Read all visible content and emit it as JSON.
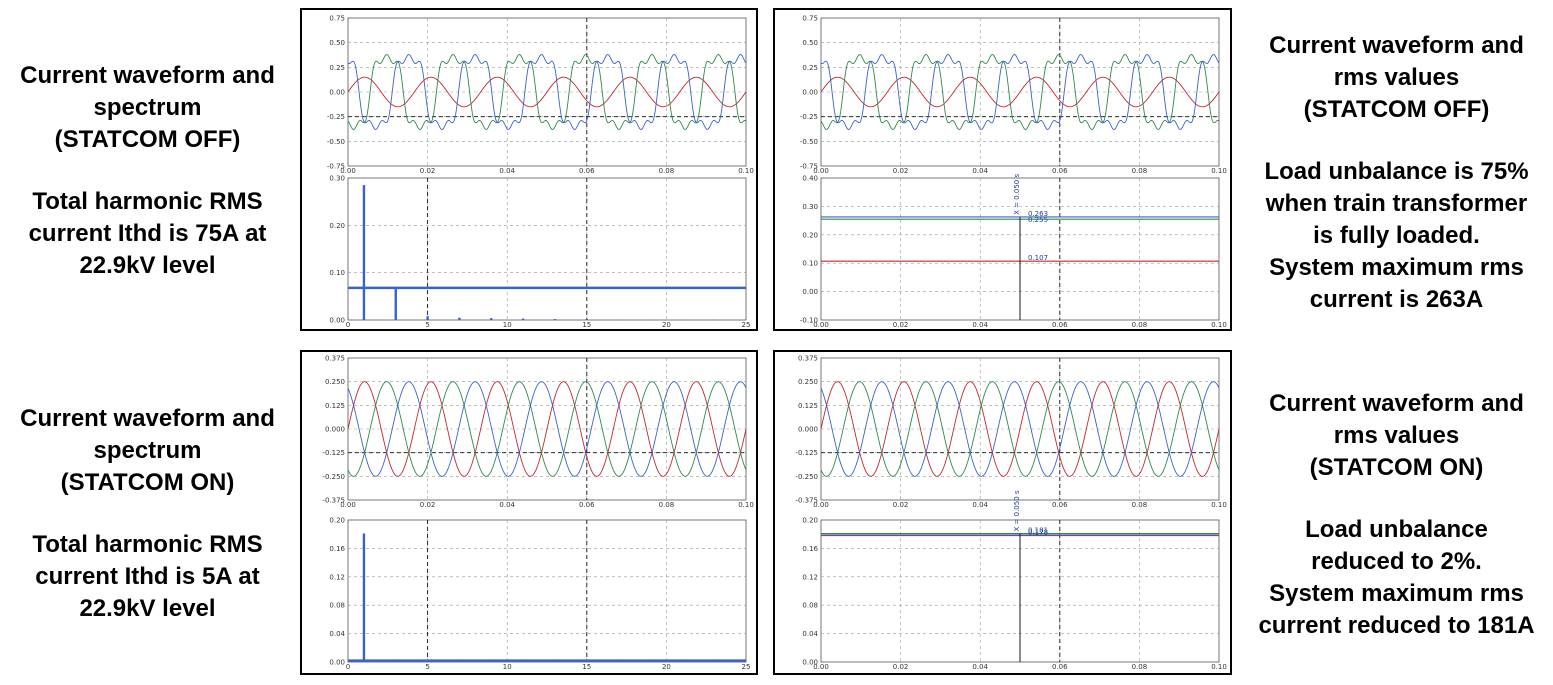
{
  "captions": {
    "top_left": {
      "title": [
        "Current waveform and",
        "spectrum",
        "(STATCOM OFF)"
      ],
      "body": [
        "Total harmonic RMS",
        "current Ithd is 75A at",
        "22.9kV level"
      ]
    },
    "top_right": {
      "title": [
        "Current waveform and",
        "rms values",
        "(STATCOM OFF)"
      ],
      "body": [
        "Load unbalance is 75%",
        "when train transformer",
        "is fully loaded.",
        "System maximum rms",
        "current is 263A"
      ]
    },
    "bottom_left": {
      "title": [
        "Current waveform and",
        "spectrum",
        "(STATCOM ON)"
      ],
      "body": [
        "Total harmonic RMS",
        "current Ithd is 5A at",
        "22.9kV level"
      ]
    },
    "bottom_right": {
      "title": [
        "Current waveform and",
        "rms values",
        "(STATCOM ON)"
      ],
      "body": [
        "Load unbalance",
        "reduced to 2%.",
        "System maximum rms",
        "current reduced to 181A"
      ]
    }
  },
  "colors": {
    "phase_a": "#c0282f",
    "phase_b": "#2d8a4e",
    "phase_c": "#3a63c8",
    "bar": "#3a63c8",
    "marker": "#1a1a1a",
    "grid": "#9a9a9a"
  },
  "chart_data": [
    {
      "id": "off-waveform",
      "type": "line",
      "xlim": [
        0,
        0.1
      ],
      "ylim": [
        -0.75,
        0.75
      ],
      "yticks": [
        "0.75",
        "0.50",
        "0.25",
        "0.00",
        "-0.25",
        "-0.50",
        "-0.75"
      ],
      "xticks": [
        "0.00",
        "0.02",
        "0.04",
        "0.06",
        "0.08",
        "0.10"
      ],
      "series": [
        {
          "amplitude": 0.15,
          "phase_deg": 0,
          "h3": 0.0,
          "h5": 0.0
        },
        {
          "amplitude": 0.4,
          "phase_deg": -120,
          "h3": 0.08,
          "h5": 0.06
        },
        {
          "amplitude": 0.4,
          "phase_deg": 120,
          "h3": 0.08,
          "h5": 0.06
        }
      ]
    },
    {
      "id": "off-spectrum",
      "type": "bar",
      "xlim": [
        0,
        25
      ],
      "ylim": [
        0,
        0.3
      ],
      "yticks": [
        "0.30",
        "0.20",
        "0.10",
        "0.00"
      ],
      "xticks": [
        "0",
        "5",
        "10",
        "15",
        "20",
        "25"
      ],
      "harmonics": [
        1,
        3,
        5,
        7,
        9,
        11,
        13,
        15,
        17,
        19,
        21,
        23
      ],
      "values": [
        0.285,
        0.068,
        0.008,
        0.005,
        0.004,
        0.003,
        0.002,
        0.002,
        0.001,
        0.001,
        0.001,
        0.001
      ],
      "ithd_level": 0.068
    },
    {
      "id": "off-rms-waveform",
      "type": "line",
      "xlim": [
        0,
        0.1
      ],
      "ylim": [
        -0.75,
        0.75
      ],
      "yticks": [
        "0.75",
        "0.50",
        "0.25",
        "0.00",
        "-0.25",
        "-0.50",
        "-0.75"
      ],
      "xticks": [
        "0.00",
        "0.02",
        "0.04",
        "0.06",
        "0.08",
        "0.10"
      ]
    },
    {
      "id": "off-rms",
      "type": "line",
      "xlim": [
        0,
        0.1
      ],
      "ylim": [
        -0.1,
        0.4
      ],
      "yticks": [
        "0.40",
        "0.30",
        "0.20",
        "0.10",
        "0.00",
        "-0.10"
      ],
      "xticks": [
        "0.00",
        "0.02",
        "0.04",
        "0.06",
        "0.08",
        "0.10"
      ],
      "rms": [
        0.107,
        0.255,
        0.263
      ],
      "cursor_x": 0.05,
      "cursor_label": "X = 0.050 s",
      "value_labels": [
        "0.263",
        "0.255",
        "0.107"
      ]
    },
    {
      "id": "on-waveform",
      "type": "line",
      "xlim": [
        0,
        0.1
      ],
      "ylim": [
        -0.375,
        0.375
      ],
      "yticks": [
        "0.375",
        "0.250",
        "0.125",
        "0.000",
        "-0.125",
        "-0.250",
        "-0.375"
      ],
      "xticks": [
        "0.00",
        "0.02",
        "0.04",
        "0.06",
        "0.08",
        "0.10"
      ],
      "series": [
        {
          "amplitude": 0.25,
          "phase_deg": 0,
          "h3": 0,
          "h5": 0
        },
        {
          "amplitude": 0.25,
          "phase_deg": -120,
          "h3": 0,
          "h5": 0
        },
        {
          "amplitude": 0.25,
          "phase_deg": 120,
          "h3": 0,
          "h5": 0
        }
      ]
    },
    {
      "id": "on-spectrum",
      "type": "bar",
      "xlim": [
        0,
        25
      ],
      "ylim": [
        0,
        0.2
      ],
      "yticks": [
        "0.20",
        "0.16",
        "0.12",
        "0.08",
        "0.04",
        "0.00"
      ],
      "xticks": [
        "0",
        "5",
        "10",
        "15",
        "20",
        "25"
      ],
      "harmonics": [
        1,
        3,
        5,
        7,
        9,
        11,
        13,
        15,
        17,
        19,
        21,
        23
      ],
      "values": [
        0.181,
        0.002,
        0.002,
        0.001,
        0.001,
        0.001,
        0.001,
        0.001,
        0.001,
        0.001,
        0.001,
        0.001
      ],
      "ithd_level": 0.002
    },
    {
      "id": "on-rms-waveform",
      "type": "line",
      "xlim": [
        0,
        0.1
      ],
      "ylim": [
        -0.375,
        0.375
      ],
      "yticks": [
        "0.375",
        "0.250",
        "0.125",
        "0.000",
        "-0.125",
        "-0.250",
        "-0.375"
      ],
      "xticks": [
        "0.00",
        "0.02",
        "0.04",
        "0.06",
        "0.08",
        "0.10"
      ]
    },
    {
      "id": "on-rms",
      "type": "line",
      "xlim": [
        0,
        0.1
      ],
      "ylim": [
        0,
        0.2
      ],
      "yticks": [
        "0.20",
        "0.16",
        "0.12",
        "0.08",
        "0.04",
        "0.00"
      ],
      "xticks": [
        "0.00",
        "0.02",
        "0.04",
        "0.06",
        "0.08",
        "0.10"
      ],
      "rms": [
        0.178,
        0.181,
        0.179
      ],
      "cursor_x": 0.05,
      "cursor_label": "X = 0.050 s",
      "value_labels": [
        "0.181",
        "0.178"
      ]
    }
  ]
}
